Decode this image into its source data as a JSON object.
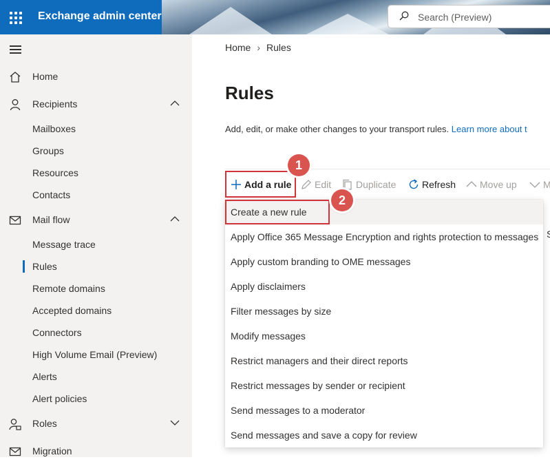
{
  "header": {
    "app_title": "Exchange admin center",
    "search_placeholder": "Search (Preview)",
    "brand_color": "#0f6cbd"
  },
  "sidebar": {
    "items": [
      {
        "label": "Home",
        "icon": "home-icon"
      },
      {
        "label": "Recipients",
        "icon": "person-icon",
        "expanded": true
      },
      {
        "label": "Mailboxes"
      },
      {
        "label": "Groups"
      },
      {
        "label": "Resources"
      },
      {
        "label": "Contacts"
      },
      {
        "label": "Mail flow",
        "icon": "mail-icon",
        "expanded": true
      },
      {
        "label": "Message trace"
      },
      {
        "label": "Rules",
        "selected": true
      },
      {
        "label": "Remote domains"
      },
      {
        "label": "Accepted domains"
      },
      {
        "label": "Connectors"
      },
      {
        "label": "High Volume Email (Preview)"
      },
      {
        "label": "Alerts"
      },
      {
        "label": "Alert policies"
      },
      {
        "label": "Roles",
        "icon": "roles-icon",
        "expanded": false
      },
      {
        "label": "Migration",
        "icon": "migration-icon"
      }
    ]
  },
  "breadcrumb": {
    "home": "Home",
    "current": "Rules"
  },
  "page": {
    "title": "Rules",
    "description": "Add, edit, or make other changes to your transport rules.",
    "learn_more": "Learn more about t"
  },
  "toolbar": {
    "add_rule": "Add a rule",
    "edit": "Edit",
    "duplicate": "Duplicate",
    "refresh": "Refresh",
    "move_up": "Move up",
    "more_cut": "M"
  },
  "annotations": {
    "step1": "1",
    "step2": "2",
    "highlight_color": "#d13438"
  },
  "dropdown": {
    "items": [
      "Create a new rule",
      "Apply Office 365 Message Encryption and rights protection to messages",
      "Apply custom branding to OME messages",
      "Apply disclaimers",
      "Filter messages by size",
      "Modify messages",
      "Restrict managers and their direct reports",
      "Restrict messages by sender or recipient",
      "Send messages to a moderator",
      "Send messages and save a copy for review"
    ]
  },
  "background_cut_text": "S"
}
